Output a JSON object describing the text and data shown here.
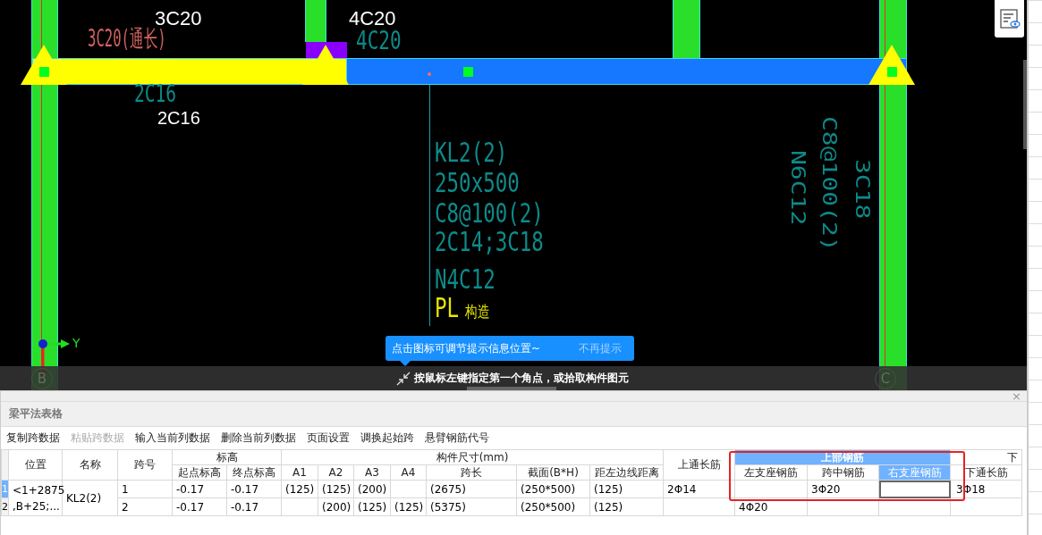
{
  "drawing": {
    "labels": [
      {
        "text": "3C20",
        "kind": "white"
      },
      {
        "text": "3C20(通长)",
        "kind": "red"
      },
      {
        "text": "4C20",
        "kind": "white"
      },
      {
        "text": "4C20",
        "kind": "teal"
      },
      {
        "text": "2C16",
        "kind": "teal"
      },
      {
        "text": "2C16",
        "kind": "white"
      },
      {
        "text": "KL2(2)",
        "kind": "teal"
      },
      {
        "text": "250x500",
        "kind": "teal"
      },
      {
        "text": "C8@100(2)",
        "kind": "teal"
      },
      {
        "text": "2C14;3C18",
        "kind": "teal"
      },
      {
        "text": "N4C12",
        "kind": "teal"
      },
      {
        "text": "PL",
        "kind": "yellow"
      },
      {
        "text": "构造",
        "kind": "yellow"
      },
      {
        "text": "3C18",
        "kind": "vertical"
      },
      {
        "text": "C8@100(2)",
        "kind": "vertical"
      },
      {
        "text": "N6C12",
        "kind": "vertical"
      }
    ],
    "axes": [
      {
        "label": "B"
      },
      {
        "label": "C"
      }
    ],
    "ucs_label": "Y"
  },
  "tooltip": {
    "text": "点击图标可调节提示信息位置~",
    "dismiss": "不再提示"
  },
  "status_bar": {
    "text": "按鼠标左键指定第一个角点，或拾取构件图元"
  },
  "panel": {
    "title": "梁平法表格",
    "close": "×",
    "toolbar": [
      {
        "label": "复制跨数据",
        "disabled": false
      },
      {
        "label": "粘贴跨数据",
        "disabled": true
      },
      {
        "label": "输入当前列数据",
        "disabled": false
      },
      {
        "label": "删除当前列数据",
        "disabled": false
      },
      {
        "label": "页面设置",
        "disabled": false
      },
      {
        "label": "调换起始跨",
        "disabled": false
      },
      {
        "label": "悬臂钢筋代号",
        "disabled": false
      }
    ],
    "header_groups": [
      {
        "label": "位置"
      },
      {
        "label": "名称"
      },
      {
        "label": "跨号"
      },
      {
        "label": "标高"
      },
      {
        "label": "构件尺寸(mm)"
      },
      {
        "label": "上通长筋"
      },
      {
        "label": "上部钢筋",
        "selected": true
      },
      {
        "label": "下",
        "selected": false
      }
    ],
    "columns": [
      {
        "label": "起点标高",
        "selected": false
      },
      {
        "label": "终点标高",
        "selected": false
      },
      {
        "label": "A1",
        "selected": false
      },
      {
        "label": "A2",
        "selected": false
      },
      {
        "label": "A3",
        "selected": false
      },
      {
        "label": "A4",
        "selected": false
      },
      {
        "label": "跨长",
        "selected": false
      },
      {
        "label": "截面(B*H)",
        "selected": false
      },
      {
        "label": "距左边线距离",
        "selected": false
      },
      {
        "label": "左支座钢筋",
        "selected": false
      },
      {
        "label": "跨中钢筋",
        "selected": false
      },
      {
        "label": "右支座钢筋",
        "selected": true
      },
      {
        "label": "下通长筋",
        "selected": false
      }
    ],
    "location": [
      "<1+2875",
      ",B+25;..."
    ],
    "name": "KL2(2)",
    "rows": [
      {
        "num": "1",
        "selected": true,
        "span": "1",
        "top_through": "2Φ14",
        "cells": [
          "-0.17",
          "-0.17",
          "(125)",
          "(125)",
          "(200)",
          "",
          "(2675)",
          "(250*500)",
          "(125)",
          "",
          "3Φ20",
          "",
          "3Φ18"
        ]
      },
      {
        "num": "2",
        "selected": false,
        "span": "2",
        "top_through": "",
        "cells": [
          "-0.17",
          "-0.17",
          "",
          "(200)",
          "(125)",
          "(125)",
          "(5375)",
          "(250*500)",
          "(125)",
          "4Φ20",
          "",
          "",
          ""
        ]
      }
    ]
  }
}
